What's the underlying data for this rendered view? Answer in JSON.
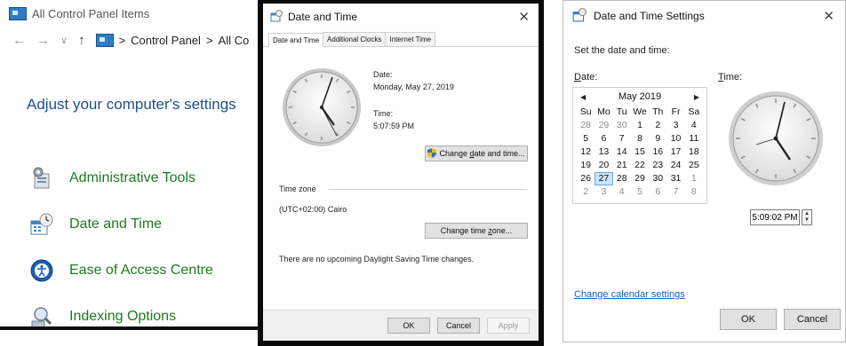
{
  "control_panel": {
    "title": "All Control Panel Items",
    "nav_back": "←",
    "nav_forward": "→",
    "nav_recent": "∨",
    "nav_up": "↑",
    "crumb_sep": ">",
    "crumb_1": "Control Panel",
    "crumb_2": "All Co",
    "heading": "Adjust your computer's settings",
    "items": [
      {
        "label": "Administrative Tools",
        "icon": "admin-tools-icon"
      },
      {
        "label": "Date and Time",
        "icon": "calendar-clock-icon"
      },
      {
        "label": "Ease of Access Centre",
        "icon": "ease-of-access-icon"
      },
      {
        "label": "Indexing Options",
        "icon": "indexing-icon"
      }
    ]
  },
  "date_time_dialog": {
    "title": "Date and Time",
    "close": "✕",
    "tabs": [
      "Date and Time",
      "Additional Clocks",
      "Internet Time"
    ],
    "date_label": "Date:",
    "date_value": "Monday, May 27, 2019",
    "time_label": "Time:",
    "time_value": "5:07:59 PM",
    "change_datetime_pre": "Change ",
    "change_datetime_ul": "d",
    "change_datetime_post": "ate and time...",
    "timezone_label": "Time zone",
    "timezone_value": "(UTC+02:00) Cairo",
    "change_timezone_pre": "Change time ",
    "change_timezone_ul": "z",
    "change_timezone_post": "one...",
    "dst_note": "There are no upcoming Daylight Saving Time changes.",
    "ok": "OK",
    "cancel": "Cancel",
    "apply": "Apply"
  },
  "settings_dialog": {
    "title": "Date and Time Settings",
    "close": "✕",
    "instruction": "Set the date and time:",
    "date_label_ul": "D",
    "date_label_rest": "ate:",
    "time_label_ul": "T",
    "time_label_rest": "ime:",
    "calendar": {
      "month": "May 2019",
      "prev": "◀",
      "next": "▶",
      "weekdays": [
        "Su",
        "Mo",
        "Tu",
        "We",
        "Th",
        "Fr",
        "Sa"
      ],
      "days": [
        [
          "28",
          "29",
          "30",
          "1",
          "2",
          "3",
          "4"
        ],
        [
          "5",
          "6",
          "7",
          "8",
          "9",
          "10",
          "11"
        ],
        [
          "12",
          "13",
          "14",
          "15",
          "16",
          "17",
          "18"
        ],
        [
          "19",
          "20",
          "21",
          "22",
          "23",
          "24",
          "25"
        ],
        [
          "26",
          "27",
          "28",
          "29",
          "30",
          "31",
          "1"
        ],
        [
          "2",
          "3",
          "4",
          "5",
          "6",
          "7",
          "8"
        ]
      ],
      "selected": "27"
    },
    "time_value": "5:09:02 PM",
    "spinner_up": "▲",
    "spinner_down": "▼",
    "change_calendar_link": "Change calendar settings",
    "ok": "OK",
    "cancel": "Cancel"
  },
  "colors": {
    "link_blue": "#1e4e8c",
    "item_green": "#1f7a1f",
    "selected_day": "#cce4f7"
  }
}
